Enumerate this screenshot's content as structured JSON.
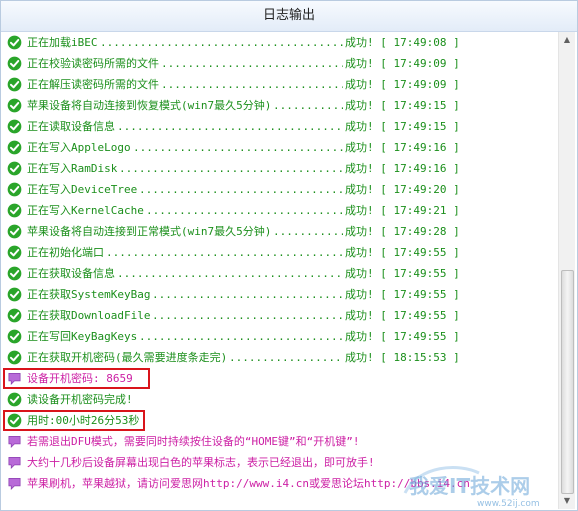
{
  "window": {
    "title": "日志输出"
  },
  "log": {
    "entries": [
      {
        "icon": "check-icon",
        "text": "正在加载iBEC",
        "tail": "成功! [ 17:49:08 ]",
        "style": "green"
      },
      {
        "icon": "check-icon",
        "text": "正在校验读密码所需的文件",
        "tail": "成功! [ 17:49:09 ]",
        "style": "green"
      },
      {
        "icon": "check-icon",
        "text": "正在解压读密码所需的文件",
        "tail": "成功! [ 17:49:09 ]",
        "style": "green"
      },
      {
        "icon": "check-icon",
        "text": "苹果设备将自动连接到恢复模式(win7最久5分钟)",
        "tail": "成功! [ 17:49:15 ]",
        "style": "green"
      },
      {
        "icon": "check-icon",
        "text": "正在读取设备信息",
        "tail": "成功! [ 17:49:15 ]",
        "style": "green"
      },
      {
        "icon": "check-icon",
        "text": "正在写入AppleLogo",
        "tail": "成功! [ 17:49:16 ]",
        "style": "green"
      },
      {
        "icon": "check-icon",
        "text": "正在写入RamDisk",
        "tail": "成功! [ 17:49:16 ]",
        "style": "green"
      },
      {
        "icon": "check-icon",
        "text": "正在写入DeviceTree",
        "tail": "成功! [ 17:49:20 ]",
        "style": "green"
      },
      {
        "icon": "check-icon",
        "text": "正在写入KernelCache",
        "tail": "成功! [ 17:49:21 ]",
        "style": "green"
      },
      {
        "icon": "check-icon",
        "text": "苹果设备将自动连接到正常模式(win7最久5分钟)",
        "tail": "成功! [ 17:49:28 ]",
        "style": "green"
      },
      {
        "icon": "check-icon",
        "text": "正在初始化端口",
        "tail": "成功! [ 17:49:55 ]",
        "style": "green"
      },
      {
        "icon": "check-icon",
        "text": "正在获取设备信息",
        "tail": "成功! [ 17:49:55 ]",
        "style": "green"
      },
      {
        "icon": "check-icon",
        "text": "正在获取SystemKeyBag",
        "tail": "成功! [ 17:49:55 ]",
        "style": "green"
      },
      {
        "icon": "check-icon",
        "text": "正在获取DownloadFile",
        "tail": "成功! [ 17:49:55 ]",
        "style": "green"
      },
      {
        "icon": "check-icon",
        "text": "正在写回KeyBagKeys",
        "tail": "成功! [ 17:49:55 ]",
        "style": "green"
      },
      {
        "icon": "check-icon",
        "text": "正在获取开机密码(最久需要进度条走完)",
        "tail": "成功! [ 18:15:53 ]",
        "style": "green"
      },
      {
        "icon": "speech-bubble-icon",
        "text": "设备开机密码: 8659",
        "tail": "",
        "style": "pink",
        "highlight": true
      },
      {
        "icon": "check-icon",
        "text": "读设备开机密码完成!",
        "tail": "",
        "style": "green"
      },
      {
        "icon": "check-icon",
        "text": "用时:00小时26分53秒",
        "tail": "",
        "style": "green",
        "highlight": true
      },
      {
        "icon": "speech-bubble-icon",
        "text": "若需退出DFU模式，需要同时持续按住设备的“HOME键”和“开机键”!",
        "tail": "",
        "style": "pink"
      },
      {
        "icon": "speech-bubble-icon",
        "text": "大约十几秒后设备屏幕出现白色的苹果标志，表示已经退出，即可放手!",
        "tail": "",
        "style": "pink"
      },
      {
        "icon": "speech-bubble-icon",
        "text": "苹果刷机，苹果越狱，请访问爱思网http://www.i4.cn或爱思论坛http://bbs.i4.cn",
        "tail": "",
        "style": "pink"
      }
    ]
  },
  "watermark": {
    "main": "我爱IT技术网",
    "sub": "www.52ij.com"
  },
  "colors": {
    "success": "#1b8f1b",
    "info": "#cc1fa4",
    "highlight_border": "#d9141b",
    "check_fill": "#2aa52a",
    "bubble_fill": "#b86ad8"
  }
}
